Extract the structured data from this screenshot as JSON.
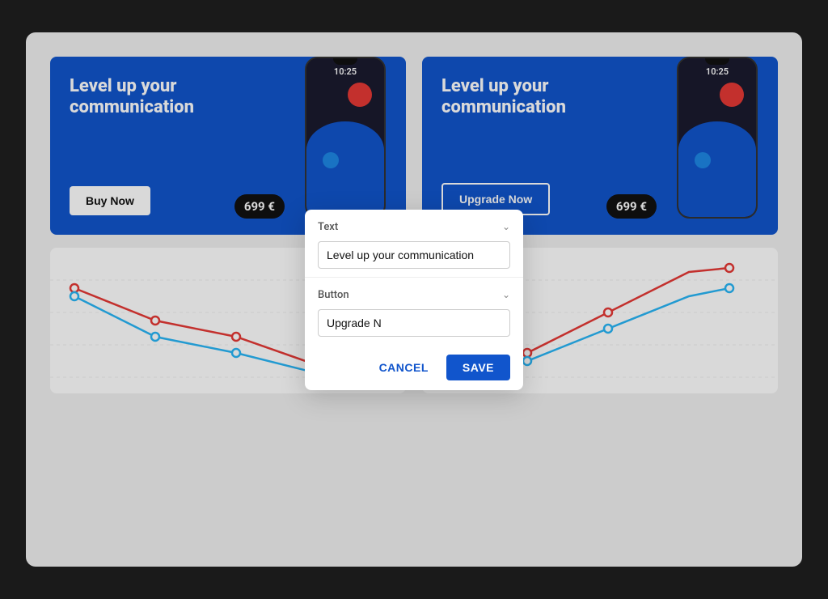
{
  "panels": [
    {
      "id": "left-panel",
      "title": "Level up your communication",
      "price": "699 €",
      "button_label": "Buy Now",
      "button_type": "solid",
      "phone_time": "10:25"
    },
    {
      "id": "right-panel",
      "title": "Level up your communication",
      "price": "699 €",
      "button_label": "Upgrade Now",
      "button_type": "outline",
      "phone_time": "10:25"
    }
  ],
  "modal": {
    "text_section_label": "Text",
    "text_input_value": "Level up your communication",
    "button_section_label": "Button",
    "button_input_value": "Upgrade N",
    "cancel_label": "CANCEL",
    "save_label": "SAVE"
  },
  "charts": {
    "left": {
      "label": "left-chart"
    },
    "right": {
      "label": "right-chart"
    }
  }
}
